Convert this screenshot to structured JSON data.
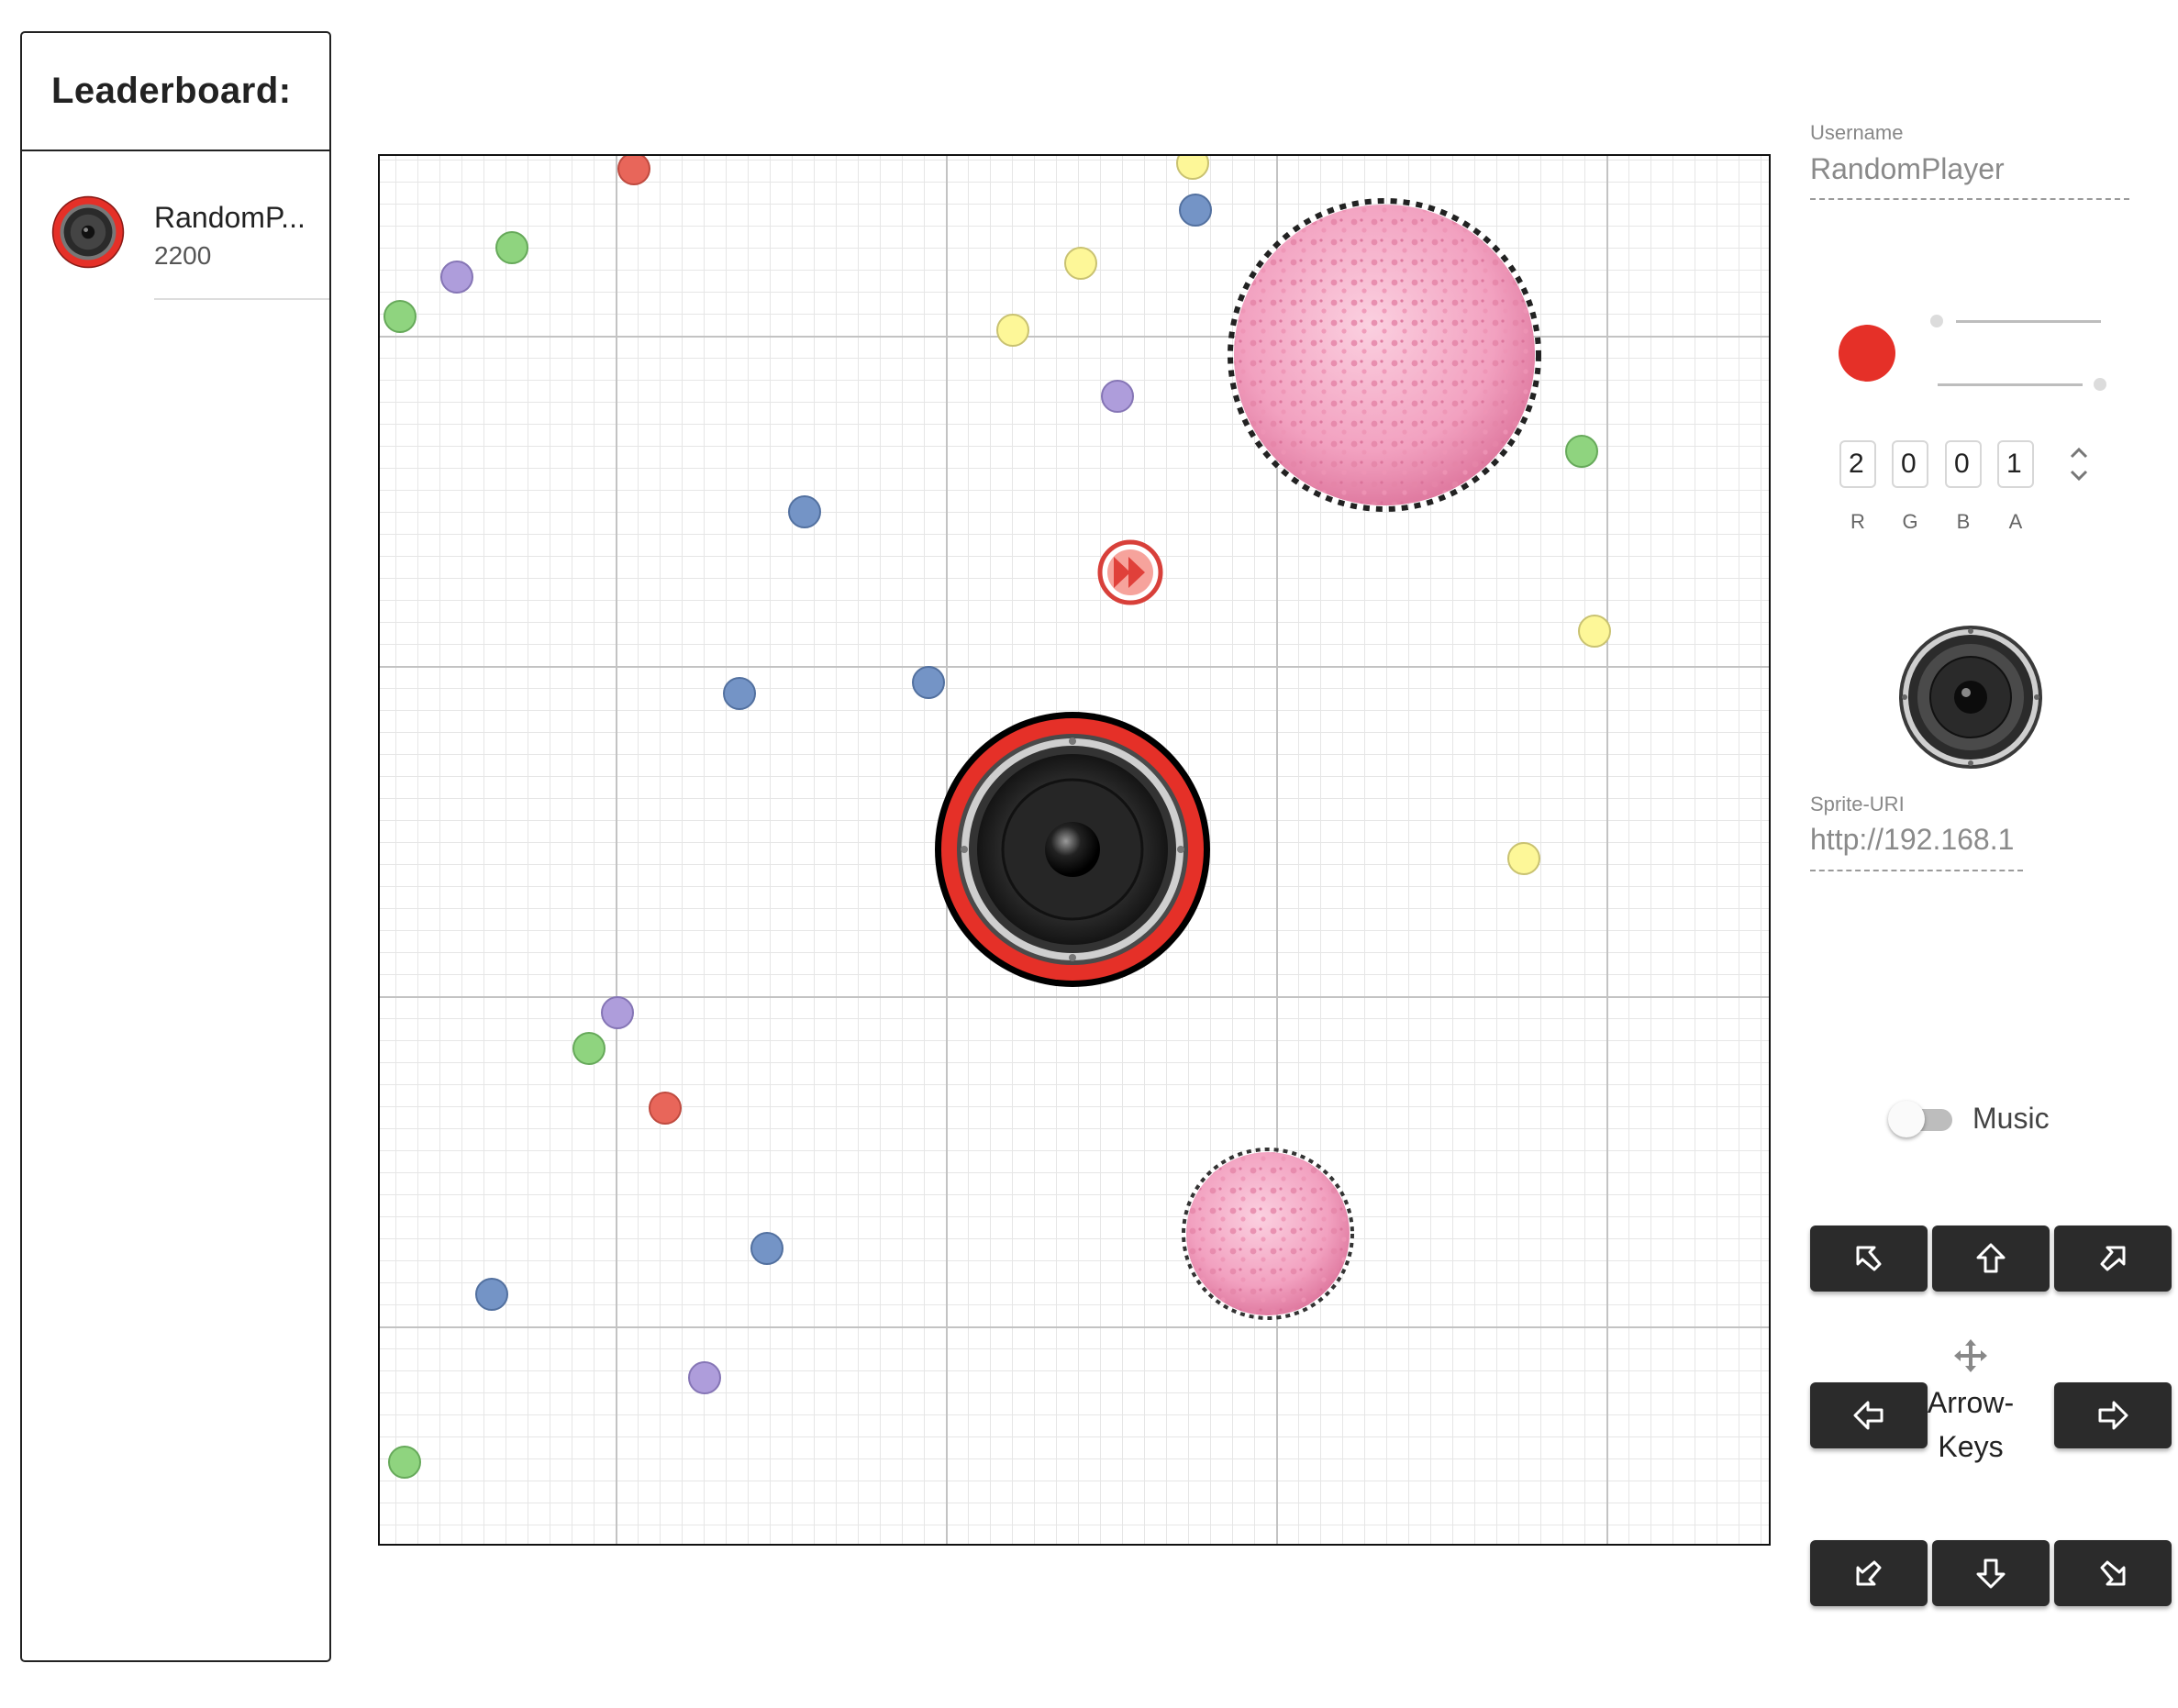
{
  "leaderboard": {
    "title": "Leaderboard:",
    "entries": [
      {
        "name": "RandomPlayer",
        "name_display": "RandomP...",
        "score": "2200"
      }
    ]
  },
  "settings": {
    "username_label": "Username",
    "username_value": "RandomPlayer",
    "color": {
      "hex": "#e53028",
      "r": "2",
      "g": "0",
      "b": "0",
      "a": "1",
      "r_label": "R",
      "g_label": "G",
      "b_label": "B",
      "a_label": "A",
      "slider1_level": 0,
      "slider2_level": 1
    },
    "sprite_label": "Sprite-URI",
    "sprite_value": "http://192.168.1",
    "music_label": "Music",
    "music_on": false
  },
  "controls": {
    "label_line1": "Arrow-",
    "label_line2": "Keys",
    "buttons": [
      "up-left",
      "up",
      "up-right",
      "left",
      "right",
      "down-left",
      "down",
      "down-right"
    ]
  },
  "game": {
    "player": {
      "name": "RandomPlayer",
      "ring_color": "#e53028"
    },
    "food_colors": {
      "red": "#e8665a",
      "green": "#8fd47f",
      "purple": "#ae9ddb",
      "blue": "#7494c6",
      "yellow": "#fdf798"
    },
    "powerup_icon": "fast-forward-icon",
    "virus_color": "#f4a7c4"
  }
}
